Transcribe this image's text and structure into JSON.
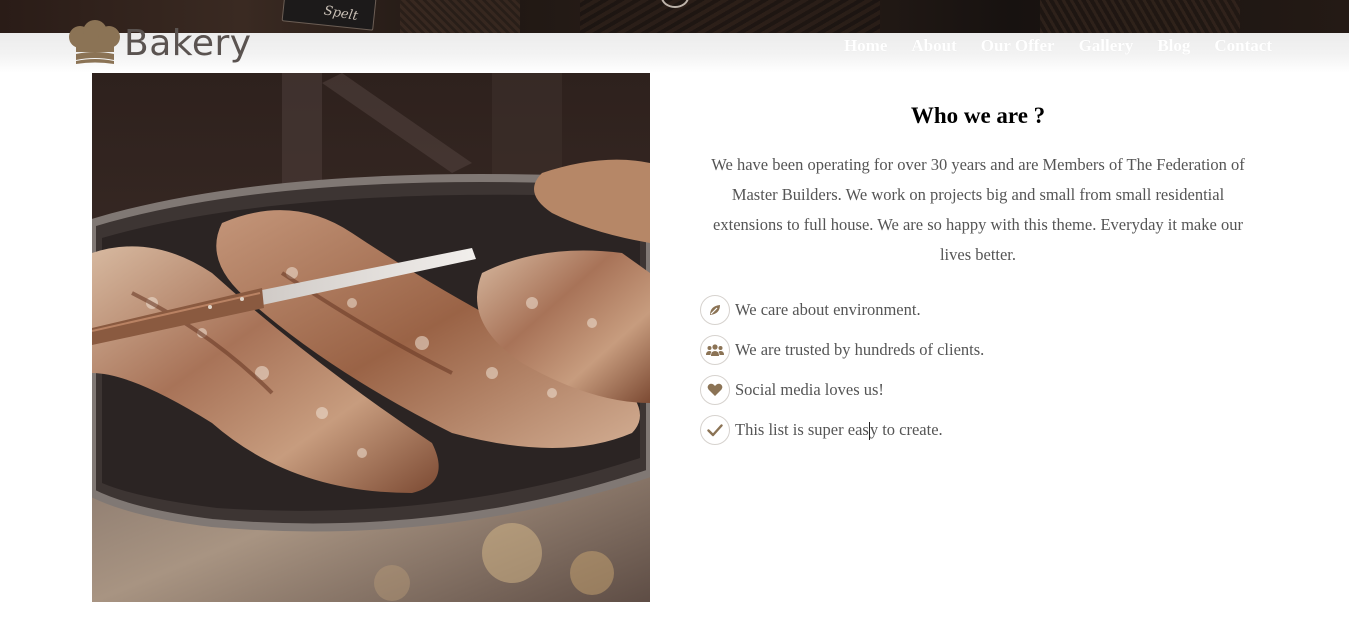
{
  "brand": {
    "name": "Bakery",
    "accent_color": "#8b7355",
    "logo_icon": "chef-hat-icon"
  },
  "hero": {
    "sign_text": "Spelt"
  },
  "nav": {
    "items": [
      {
        "label": "Home"
      },
      {
        "label": "About"
      },
      {
        "label": "Our Offer"
      },
      {
        "label": "Gallery"
      },
      {
        "label": "Blog"
      },
      {
        "label": "Contact"
      }
    ]
  },
  "about": {
    "title": "Who we are ?",
    "body": "We have been operating for over 30 years and are Members of The Federation of Master Builders. We work on projects big and small from small residential extensions to full house. We are so happy with this theme. Everyday it make our lives better.",
    "features": [
      {
        "icon": "leaf-icon",
        "text": "We care about environment."
      },
      {
        "icon": "users-icon",
        "text": "We are trusted by hundreds of clients."
      },
      {
        "icon": "heart-icon",
        "text": "Social media loves us!"
      },
      {
        "icon": "check-icon",
        "text_before_caret": "This list is super eas",
        "text_after_caret": "y to create."
      }
    ]
  }
}
